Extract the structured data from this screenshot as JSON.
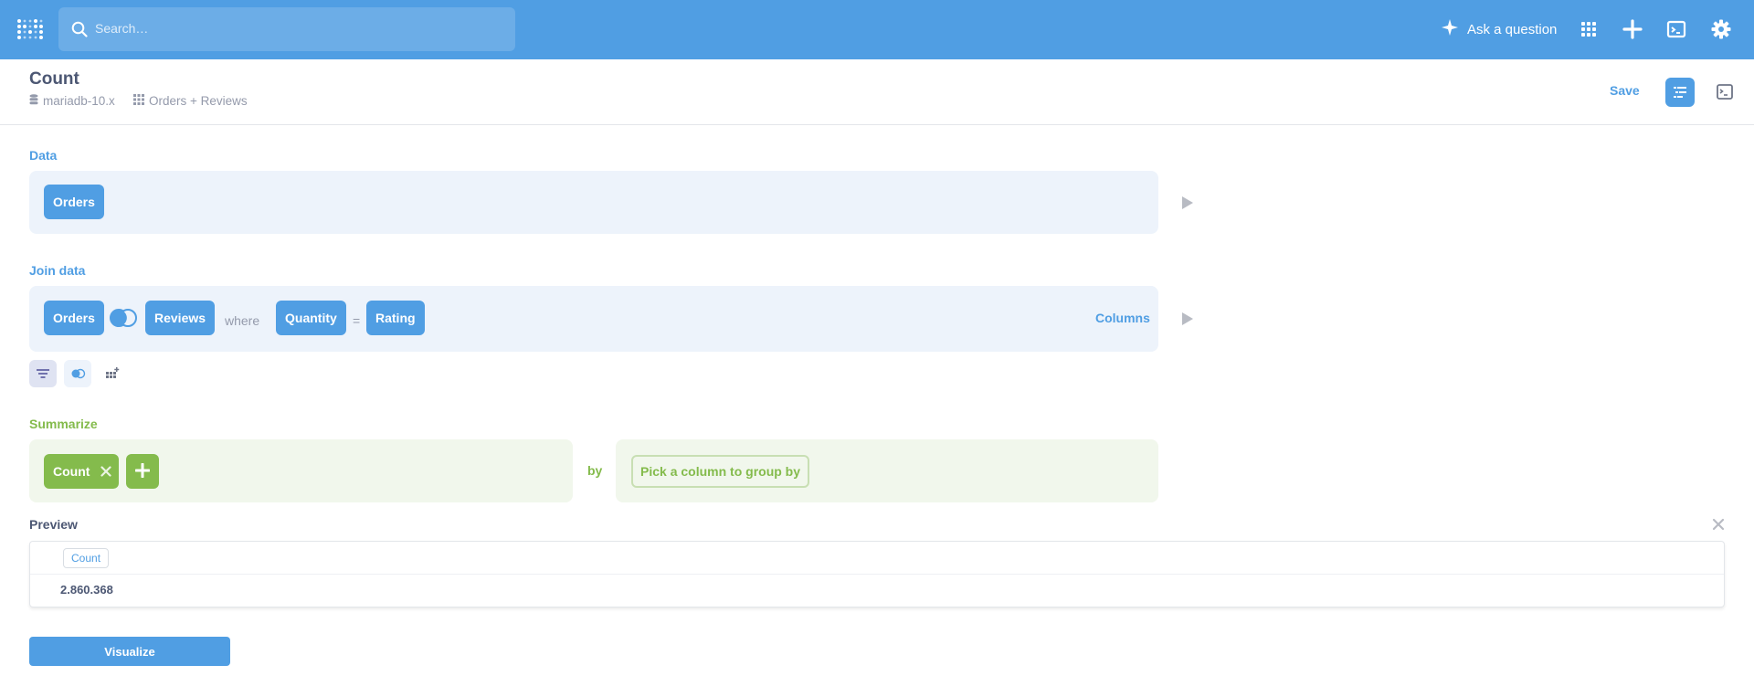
{
  "navbar": {
    "search_placeholder": "Search…",
    "ask_label": "Ask a question",
    "icons": [
      "logo-icon",
      "search-icon",
      "sparkle-icon",
      "grid-icon",
      "plus-icon",
      "terminal-icon",
      "gear-icon"
    ]
  },
  "header": {
    "title": "Count",
    "database": "mariadb-10.x",
    "tables": "Orders + Reviews",
    "save_label": "Save"
  },
  "data_section": {
    "label": "Data",
    "table": "Orders"
  },
  "join_section": {
    "label": "Join data",
    "left_table": "Orders",
    "right_table": "Reviews",
    "where_label": "where",
    "left_column": "Quantity",
    "operator": "=",
    "right_column": "Rating",
    "columns_label": "Columns"
  },
  "summarize_section": {
    "label": "Summarize",
    "metric": "Count",
    "by_label": "by",
    "group_placeholder": "Pick a column to group by"
  },
  "preview": {
    "label": "Preview",
    "column": "Count",
    "value": "2.860.368"
  },
  "visualize_label": "Visualize",
  "colors": {
    "brand": "#509ee3",
    "summarize": "#84bb4c"
  }
}
